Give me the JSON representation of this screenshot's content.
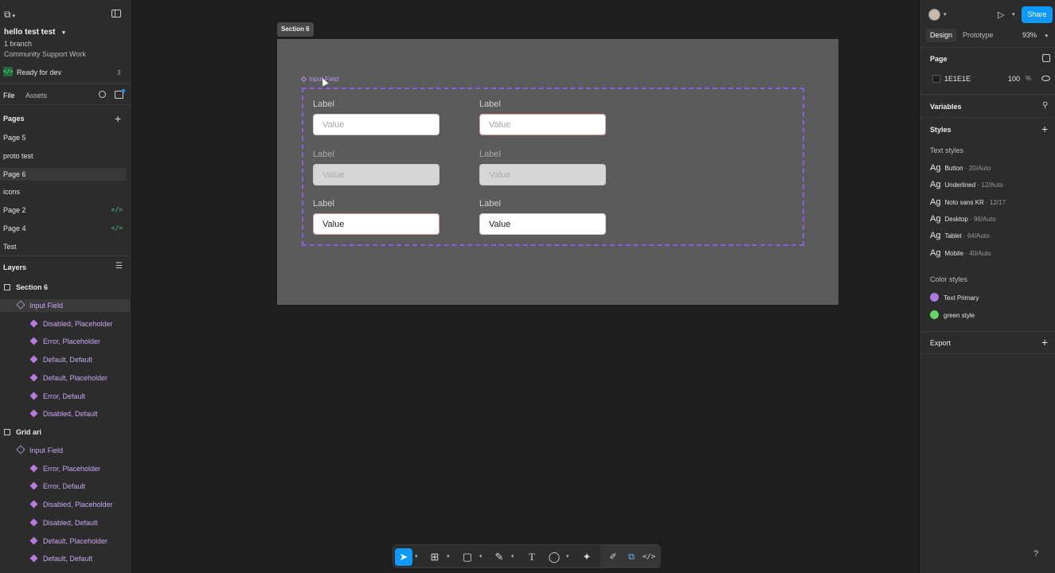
{
  "file": {
    "name": "hello test test",
    "branches": "1 branch",
    "team": "Community Support Work",
    "status": "Ready for dev",
    "status_count": "3"
  },
  "left_tabs": [
    "File",
    "Assets"
  ],
  "pages": {
    "title": "Pages",
    "items": [
      {
        "label": "Page 5",
        "dev": false,
        "active": false
      },
      {
        "label": "proto test",
        "dev": false,
        "active": false
      },
      {
        "label": "Page 6",
        "dev": false,
        "active": true
      },
      {
        "label": "icons",
        "dev": false,
        "active": false
      },
      {
        "label": "Page 2",
        "dev": true,
        "active": false
      },
      {
        "label": "Page 4",
        "dev": true,
        "active": false
      },
      {
        "label": "Test",
        "dev": false,
        "active": false
      }
    ]
  },
  "layers": {
    "title": "Layers",
    "items": [
      {
        "label": "Section 6",
        "kind": "section"
      },
      {
        "label": "Input Field",
        "kind": "componentset",
        "selected": true
      },
      {
        "label": "Disabled, Placeholder",
        "kind": "variant"
      },
      {
        "label": "Error, Placeholder",
        "kind": "variant"
      },
      {
        "label": "Default, Default",
        "kind": "variant"
      },
      {
        "label": "Default, Placeholder",
        "kind": "variant"
      },
      {
        "label": "Error, Default",
        "kind": "variant"
      },
      {
        "label": "Disabled, Default",
        "kind": "variant"
      },
      {
        "label": "Grid ari",
        "kind": "section"
      },
      {
        "label": "Input Field",
        "kind": "componentset"
      },
      {
        "label": "Error, Placeholder",
        "kind": "variant"
      },
      {
        "label": "Error, Default",
        "kind": "variant"
      },
      {
        "label": "Disabled, Placeholder",
        "kind": "variant"
      },
      {
        "label": "Disabled, Default",
        "kind": "variant"
      },
      {
        "label": "Default, Placeholder",
        "kind": "variant"
      },
      {
        "label": "Default, Default",
        "kind": "variant"
      }
    ]
  },
  "canvas": {
    "section_label": "Section 6",
    "component_label": "Input Field",
    "fields": [
      {
        "label": "Label",
        "value": "Value",
        "state": "default"
      },
      {
        "label": "Label",
        "value": "Value",
        "state": "error"
      },
      {
        "label": "Label",
        "value": "Value",
        "state": "disabled"
      },
      {
        "label": "Label",
        "value": "Value",
        "state": "disabled"
      },
      {
        "label": "Label",
        "value": "Value",
        "state": "error-filled"
      },
      {
        "label": "Label",
        "value": "Value",
        "state": "default-filled"
      }
    ]
  },
  "right": {
    "tabs": [
      "Design",
      "Prototype"
    ],
    "zoom": "93%",
    "share": "Share",
    "page_title": "Page",
    "page_color": "1E1E1E",
    "page_opacity": "100",
    "page_opacity_unit": "%",
    "variables": "Variables",
    "styles": "Styles",
    "text_styles_title": "Text styles",
    "text_styles": [
      {
        "name": "Button",
        "meta": " · 20/Auto"
      },
      {
        "name": "Underlined",
        "meta": " · 12/Auto"
      },
      {
        "name": "Noto sans KR",
        "meta": " · 12/17"
      },
      {
        "name": "Desktop",
        "meta": " · 96/Auto"
      },
      {
        "name": "Tablet",
        "meta": " · 64/Auto"
      },
      {
        "name": "Mobile",
        "meta": " · 40/Auto"
      }
    ],
    "color_styles_title": "Color styles",
    "color_styles": [
      {
        "name": "Text Primary",
        "color": "#a77be0"
      },
      {
        "name": "green style",
        "color": "#6ad36a"
      }
    ],
    "export": "Export"
  },
  "colors": {
    "accent": "#0d99ff",
    "component": "#8c5ee0",
    "dev_green": "#4fc27a"
  }
}
